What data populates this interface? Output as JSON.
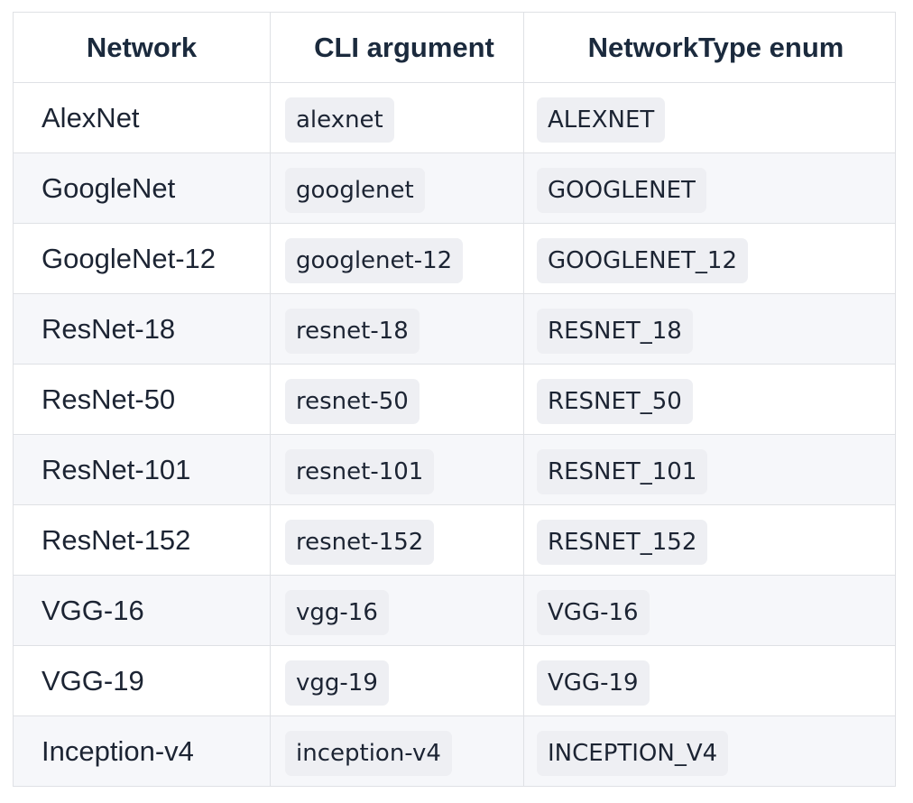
{
  "headers": [
    "Network",
    "CLI argument",
    "NetworkType enum"
  ],
  "rows": [
    {
      "network": "AlexNet",
      "cli": "alexnet",
      "enum": "ALEXNET"
    },
    {
      "network": "GoogleNet",
      "cli": "googlenet",
      "enum": "GOOGLENET"
    },
    {
      "network": "GoogleNet-12",
      "cli": "googlenet-12",
      "enum": "GOOGLENET_12"
    },
    {
      "network": "ResNet-18",
      "cli": "resnet-18",
      "enum": "RESNET_18"
    },
    {
      "network": "ResNet-50",
      "cli": "resnet-50",
      "enum": "RESNET_50"
    },
    {
      "network": "ResNet-101",
      "cli": "resnet-101",
      "enum": "RESNET_101"
    },
    {
      "network": "ResNet-152",
      "cli": "resnet-152",
      "enum": "RESNET_152"
    },
    {
      "network": "VGG-16",
      "cli": "vgg-16",
      "enum": "VGG-16"
    },
    {
      "network": "VGG-19",
      "cli": "vgg-19",
      "enum": "VGG-19"
    },
    {
      "network": "Inception-v4",
      "cli": "inception-v4",
      "enum": "INCEPTION_V4"
    }
  ]
}
